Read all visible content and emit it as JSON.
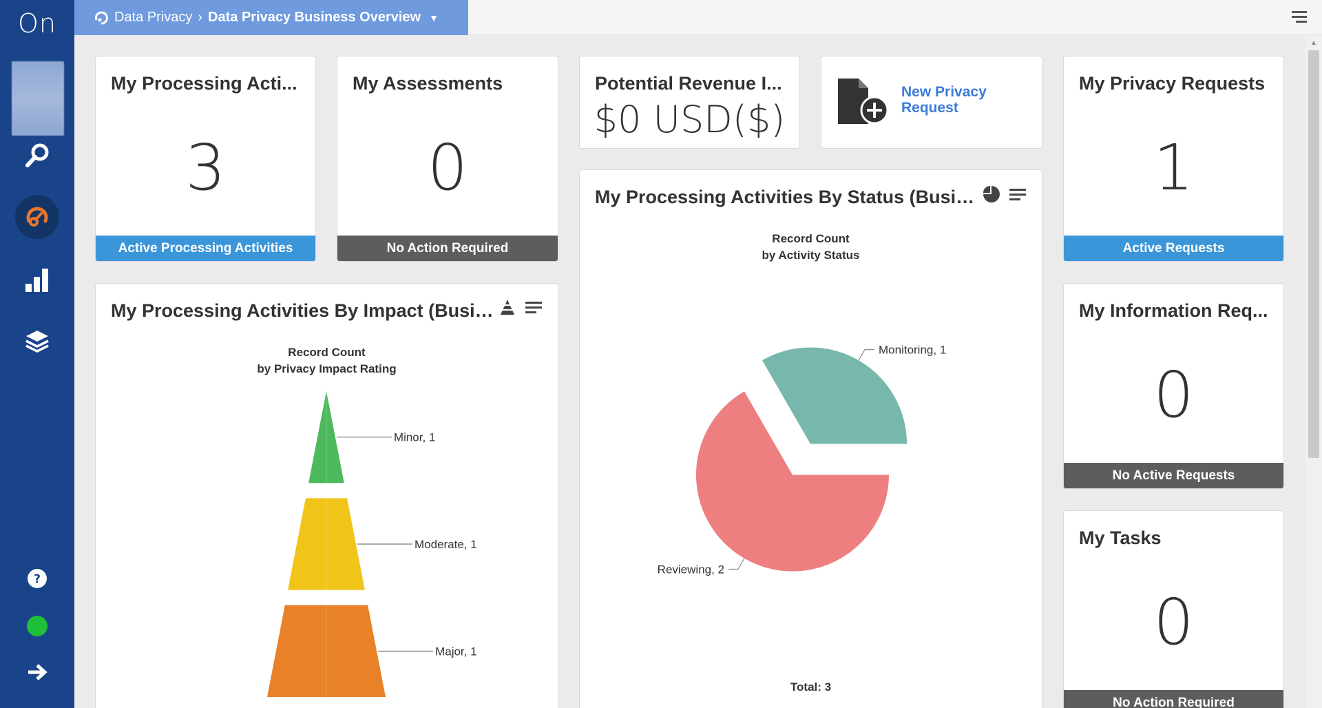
{
  "sidebar": {
    "logo": "On",
    "icons": [
      "search-icon",
      "dashboard-gauge-icon",
      "bar-chart-icon",
      "layers-icon",
      "help-icon",
      "status-dot",
      "logout-arrow-icon"
    ],
    "status_color": "#1fbf3a"
  },
  "breadcrumb": {
    "parent": "Data Privacy",
    "current": "Data Privacy Business Overview"
  },
  "cards": {
    "processing": {
      "title": "My Processing Acti...",
      "value": "3",
      "footer": "Active Processing Activities"
    },
    "assessments": {
      "title": "My Assessments",
      "value": "0",
      "footer": "No Action Required"
    },
    "revenue": {
      "title": "Potential Revenue I...",
      "value": "$0 USD($)"
    },
    "new_request": {
      "label": "New Privacy Request"
    },
    "privacy_requests": {
      "title": "My Privacy Requests",
      "value": "1",
      "footer": "Active Requests"
    },
    "info_requests": {
      "title": "My Information Req...",
      "value": "0",
      "footer": "No Active Requests"
    },
    "tasks": {
      "title": "My Tasks",
      "value": "0",
      "footer": "No Action Required"
    }
  },
  "impact_chart": {
    "title": "My Processing Activities By Impact (Busine...",
    "subtitle_line1": "Record Count",
    "subtitle_line2": "by Privacy Impact Rating"
  },
  "status_chart": {
    "title": "My Processing Activities By Status (Busine...",
    "subtitle_line1": "Record Count",
    "subtitle_line2": "by Activity Status",
    "total": "Total: 3"
  },
  "colors": {
    "sidebar": "#1a4489",
    "breadcrumb": "#6f9ade",
    "footer_blue": "#3b95d9",
    "footer_gray": "#5d5d5d",
    "link": "#3b7dd8"
  },
  "chart_data": [
    {
      "type": "pyramid",
      "title": "Record Count",
      "subtitle": "by Privacy Impact Rating",
      "categories": [
        "Minor",
        "Moderate",
        "Major"
      ],
      "values": [
        1,
        1,
        1
      ],
      "labels": [
        "Minor, 1",
        "Moderate, 1",
        "Major, 1"
      ],
      "colors": [
        "#4cba5c",
        "#f0c419",
        "#e88128"
      ]
    },
    {
      "type": "pie",
      "title": "Record Count",
      "subtitle": "by Activity Status",
      "categories": [
        "Reviewing",
        "Monitoring"
      ],
      "values": [
        2,
        1
      ],
      "labels": [
        "Reviewing, 2",
        "Monitoring, 1"
      ],
      "colors": [
        "#ee7f80",
        "#78b7ab"
      ],
      "total": "Total: 3"
    }
  ]
}
